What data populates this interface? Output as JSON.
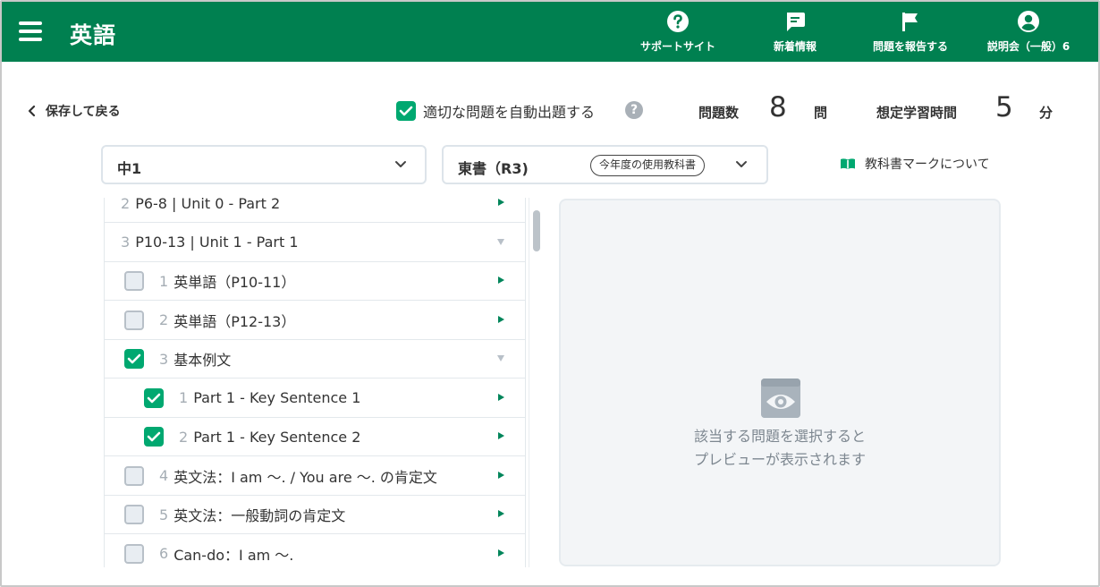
{
  "header": {
    "title": "英語",
    "nav": [
      {
        "label": "サポートサイト",
        "icon": "help-circle-icon"
      },
      {
        "label": "新着情報",
        "icon": "message-icon"
      },
      {
        "label": "問題を報告する",
        "icon": "flag-icon"
      },
      {
        "label": "説明会（一般）6",
        "icon": "user-icon"
      }
    ]
  },
  "toolbar": {
    "back_label": "保存して戻る",
    "auto_label": "適切な問題を自動出題する",
    "auto_checked": true,
    "question_count_label": "問題数",
    "question_count": "8",
    "question_unit": "問",
    "study_time_label": "想定学習時間",
    "study_time": "5",
    "study_unit": "分"
  },
  "selectors": {
    "grade": "中1",
    "textbook": "東書（R3)",
    "textbook_badge": "今年度の使用教科書",
    "about_mark": "教科書マークについて"
  },
  "list": [
    {
      "num": "2",
      "label": "P6-8 | Unit 0 - Part 2",
      "level": 0,
      "checkbox": false,
      "expanded": false
    },
    {
      "num": "3",
      "label": "P10-13 | Unit 1 - Part 1",
      "level": 0,
      "checkbox": false,
      "expanded": true
    },
    {
      "num": "1",
      "label": "英単語（P10-11）",
      "level": 1,
      "checkbox": true,
      "checked": false,
      "expanded": false
    },
    {
      "num": "2",
      "label": "英単語（P12-13）",
      "level": 1,
      "checkbox": true,
      "checked": false,
      "expanded": false
    },
    {
      "num": "3",
      "label": "基本例文",
      "level": 1,
      "checkbox": true,
      "checked": true,
      "expanded": true
    },
    {
      "num": "1",
      "label": "Part 1 - Key Sentence 1",
      "level": 2,
      "checkbox": true,
      "checked": true,
      "expanded": false
    },
    {
      "num": "2",
      "label": "Part 1 - Key Sentence 2",
      "level": 2,
      "checkbox": true,
      "checked": true,
      "expanded": false
    },
    {
      "num": "4",
      "label": "英文法：I am 〜. / You are 〜. の肯定文",
      "level": 1,
      "checkbox": true,
      "checked": false,
      "expanded": false
    },
    {
      "num": "5",
      "label": "英文法：一般動詞の肯定文",
      "level": 1,
      "checkbox": true,
      "checked": false,
      "expanded": false
    },
    {
      "num": "6",
      "label": "Can-do：I am 〜.",
      "level": 1,
      "checkbox": true,
      "checked": false,
      "expanded": false
    }
  ],
  "preview": {
    "message_line1": "該当する問題を選択すると",
    "message_line2": "プレビューが表示されます"
  },
  "colors": {
    "brand": "#008050",
    "check": "#00a870"
  }
}
